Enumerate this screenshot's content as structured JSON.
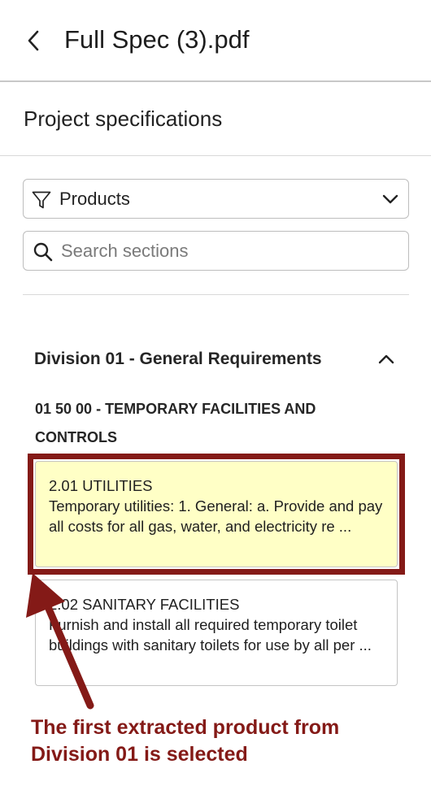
{
  "header": {
    "title": "Full Spec (3).pdf",
    "back_icon": "chevron-left-icon"
  },
  "panel": {
    "title": "Project specifications"
  },
  "filter": {
    "icon": "filter-funnel-icon",
    "selected": "Products",
    "chevron_icon": "chevron-down-icon"
  },
  "search": {
    "icon": "search-icon",
    "placeholder": "Search sections",
    "value": ""
  },
  "division": {
    "title": "Division 01 - General Requirements",
    "collapse_icon": "chevron-up-icon",
    "section_title": "01 50 00 - TEMPORARY FACILITIES AND CONTROLS",
    "items": [
      {
        "code_title": "2.01 UTILITIES",
        "excerpt": "Temporary utilities: 1. General: a. Provide and pay all costs for all gas, water, and electricity re ...",
        "selected": true
      },
      {
        "code_title": "2.02 SANITARY FACILITIES",
        "excerpt": "Furnish and install all required temporary toilet buildings with sanitary toilets for use by all per ...",
        "selected": false
      }
    ]
  },
  "annotation": {
    "text": "The first extracted product from Division 01 is selected",
    "color": "#841a17"
  },
  "colors": {
    "selected_card_bg": "#ffffc6",
    "highlight": "#841a17",
    "border": "#c4c4c4"
  }
}
